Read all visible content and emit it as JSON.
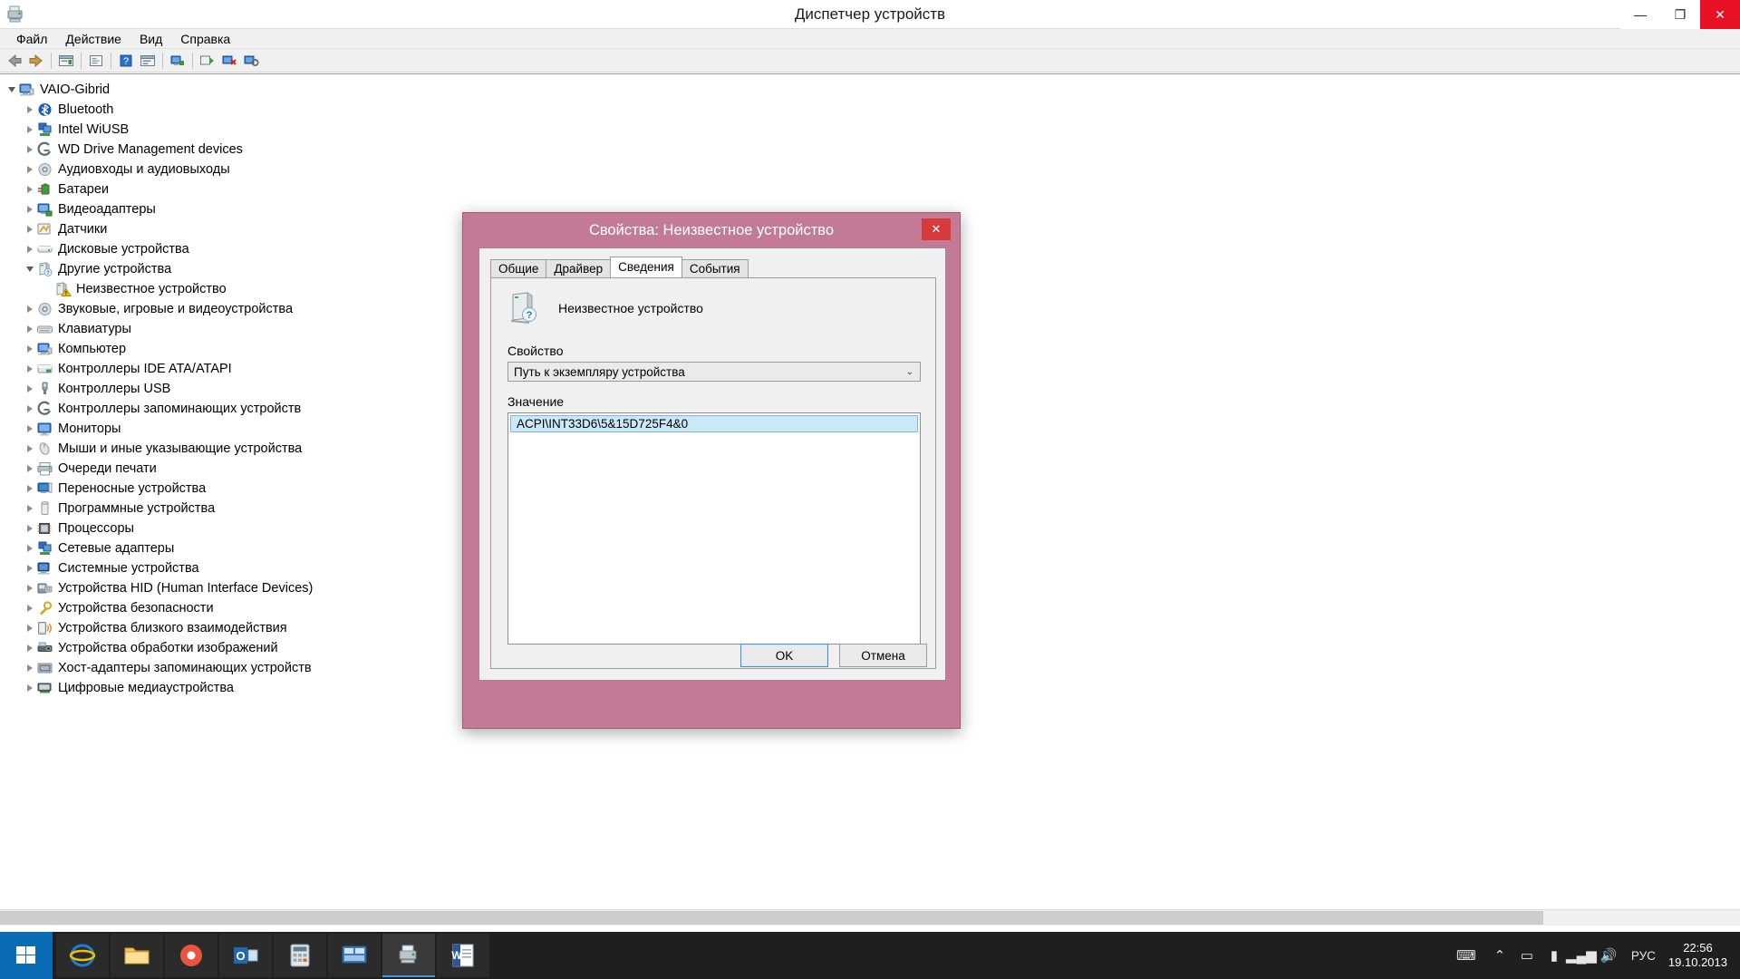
{
  "window": {
    "title": "Диспетчер устройств",
    "app_icon": "device-manager-icon",
    "controls": {
      "minimize": "—",
      "maximize": "❐",
      "close": "✕"
    }
  },
  "menubar": {
    "items": [
      {
        "label": "Файл",
        "name": "menu-file"
      },
      {
        "label": "Действие",
        "name": "menu-action"
      },
      {
        "label": "Вид",
        "name": "menu-view"
      },
      {
        "label": "Справка",
        "name": "menu-help"
      }
    ]
  },
  "toolbar": {
    "buttons": [
      {
        "name": "back-icon",
        "glyph": "◀"
      },
      {
        "name": "forward-icon",
        "glyph": "▶"
      },
      {
        "name": "properties-icon",
        "glyph": "▤"
      },
      {
        "name": "show-hidden-icon",
        "glyph": "▣"
      },
      {
        "name": "help-icon",
        "glyph": "?"
      },
      {
        "name": "device-list-icon",
        "glyph": "▤"
      },
      {
        "name": "scan-hardware-icon",
        "glyph": "▥"
      },
      {
        "name": "update-driver-icon",
        "glyph": "▤"
      },
      {
        "name": "disable-device-icon",
        "glyph": "▦"
      },
      {
        "name": "uninstall-device-icon",
        "glyph": "▧"
      }
    ]
  },
  "tree": {
    "root": {
      "label": "VAIO-Gibrid",
      "icon": "computer-icon",
      "expanded": true
    },
    "items": [
      {
        "label": "Bluetooth",
        "icon": "bluetooth-icon",
        "indent": 1,
        "expandable": true
      },
      {
        "label": "Intel WiUSB",
        "icon": "network-icon",
        "indent": 1,
        "expandable": true
      },
      {
        "label": "WD Drive Management devices",
        "icon": "storage-controller-icon",
        "indent": 1,
        "expandable": true
      },
      {
        "label": "Аудиовходы и аудиовыходы",
        "icon": "audio-icon",
        "indent": 1,
        "expandable": true
      },
      {
        "label": "Батареи",
        "icon": "battery-icon",
        "indent": 1,
        "expandable": true
      },
      {
        "label": "Видеоадаптеры",
        "icon": "display-adapter-icon",
        "indent": 1,
        "expandable": true
      },
      {
        "label": "Датчики",
        "icon": "sensor-icon",
        "indent": 1,
        "expandable": true
      },
      {
        "label": "Дисковые устройства",
        "icon": "disk-drive-icon",
        "indent": 1,
        "expandable": true
      },
      {
        "label": "Другие устройства",
        "icon": "other-devices-icon",
        "indent": 1,
        "expandable": true,
        "expanded": true
      },
      {
        "label": "Неизвестное устройство",
        "icon": "unknown-device-icon",
        "indent": 2,
        "expandable": false,
        "warning": true
      },
      {
        "label": "Звуковые, игровые и видеоустройства",
        "icon": "audio-icon",
        "indent": 1,
        "expandable": true
      },
      {
        "label": "Клавиатуры",
        "icon": "keyboard-icon",
        "indent": 1,
        "expandable": true
      },
      {
        "label": "Компьютер",
        "icon": "computer-icon",
        "indent": 1,
        "expandable": true
      },
      {
        "label": "Контроллеры IDE ATA/ATAPI",
        "icon": "ide-controller-icon",
        "indent": 1,
        "expandable": true
      },
      {
        "label": "Контроллеры USB",
        "icon": "usb-icon",
        "indent": 1,
        "expandable": true
      },
      {
        "label": "Контроллеры запоминающих устройств",
        "icon": "storage-controller-icon",
        "indent": 1,
        "expandable": true
      },
      {
        "label": "Мониторы",
        "icon": "monitor-icon",
        "indent": 1,
        "expandable": true
      },
      {
        "label": "Мыши и иные указывающие устройства",
        "icon": "mouse-icon",
        "indent": 1,
        "expandable": true
      },
      {
        "label": "Очереди печати",
        "icon": "printer-icon",
        "indent": 1,
        "expandable": true
      },
      {
        "label": "Переносные устройства",
        "icon": "portable-device-icon",
        "indent": 1,
        "expandable": true
      },
      {
        "label": "Программные устройства",
        "icon": "software-device-icon",
        "indent": 1,
        "expandable": true
      },
      {
        "label": "Процессоры",
        "icon": "processor-icon",
        "indent": 1,
        "expandable": true
      },
      {
        "label": "Сетевые адаптеры",
        "icon": "network-icon",
        "indent": 1,
        "expandable": true
      },
      {
        "label": "Системные устройства",
        "icon": "system-device-icon",
        "indent": 1,
        "expandable": true
      },
      {
        "label": "Устройства HID (Human Interface Devices)",
        "icon": "hid-icon",
        "indent": 1,
        "expandable": true
      },
      {
        "label": "Устройства безопасности",
        "icon": "security-device-icon",
        "indent": 1,
        "expandable": true
      },
      {
        "label": "Устройства близкого взаимодействия",
        "icon": "nfc-icon",
        "indent": 1,
        "expandable": true
      },
      {
        "label": "Устройства обработки изображений",
        "icon": "imaging-device-icon",
        "indent": 1,
        "expandable": true
      },
      {
        "label": "Хост-адаптеры запоминающих устройств",
        "icon": "storage-host-icon",
        "indent": 1,
        "expandable": true
      },
      {
        "label": "Цифровые медиаустройства",
        "icon": "media-device-icon",
        "indent": 1,
        "expandable": true
      }
    ]
  },
  "dialog": {
    "title": "Свойства: Неизвестное устройство",
    "close_glyph": "✕",
    "tabs": [
      {
        "label": "Общие",
        "active": false
      },
      {
        "label": "Драйвер",
        "active": false
      },
      {
        "label": "Сведения",
        "active": true
      },
      {
        "label": "События",
        "active": false
      }
    ],
    "device_name": "Неизвестное устройство",
    "property_label": "Свойство",
    "property_value": "Путь к экземпляру устройства",
    "property_arrow": "⌄",
    "value_label": "Значение",
    "value_text": "ACPI\\INT33D6\\5&15D725F4&0",
    "buttons": {
      "ok": "OK",
      "cancel": "Отмена"
    },
    "colors": {
      "title_bar": "#c27a96",
      "selection": "#cbe8f6"
    }
  },
  "taskbar": {
    "start": {
      "name": "start-button",
      "glyph": "⊞"
    },
    "items": [
      {
        "name": "taskbar-internet-explorer",
        "glyph": "e",
        "active": false
      },
      {
        "name": "taskbar-file-explorer",
        "glyph": "🗀",
        "active": false
      },
      {
        "name": "taskbar-media-player",
        "glyph": "◕",
        "active": false
      },
      {
        "name": "taskbar-outlook",
        "glyph": "O",
        "active": false
      },
      {
        "name": "taskbar-calculator",
        "glyph": "▤",
        "active": false
      },
      {
        "name": "taskbar-control-panel",
        "glyph": "▦",
        "active": false
      },
      {
        "name": "taskbar-device-manager",
        "glyph": "▩",
        "active": true
      },
      {
        "name": "taskbar-word",
        "glyph": "W",
        "active": false
      }
    ],
    "tray": {
      "keyboard_icon": "⌨",
      "show_hidden_icon": "⌃",
      "action_center_icon": "▭",
      "battery_icon": "▮",
      "network_icon": "▂▄▆",
      "volume_icon": "🔊",
      "language": "РУС",
      "time": "22:56",
      "date": "19.10.2013"
    }
  }
}
